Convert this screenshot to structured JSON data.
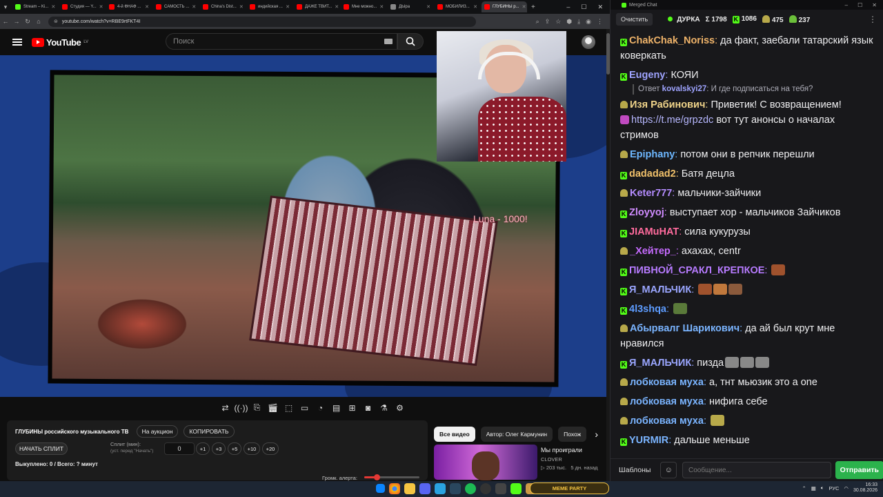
{
  "browser": {
    "tabs": [
      {
        "label": "Stream – Ki...",
        "color": "#53fc18"
      },
      {
        "label": "Студия — Y...",
        "color": "#ff0000"
      },
      {
        "label": "4-й ФНАФ ...",
        "color": "#ff0000"
      },
      {
        "label": "САМОСТЬ ...",
        "color": "#ff0000"
      },
      {
        "label": "China's Dist...",
        "color": "#ff0000"
      },
      {
        "label": "индийская ...",
        "color": "#ff0000"
      },
      {
        "label": "ДАЖЕ ТВИТ...",
        "color": "#ff0000"
      },
      {
        "label": "Мне можно...",
        "color": "#ff0000"
      },
      {
        "label": "ДЫра",
        "color": "#888888"
      },
      {
        "label": "МОБИЛИЗ...",
        "color": "#ff0000"
      },
      {
        "label": "ГЛУБИНЫ р...",
        "color": "#ff0000"
      }
    ],
    "url": "youtube.com/watch?v=RBE9rtFKT4I"
  },
  "youtube": {
    "logo": "YouTube",
    "region": "LV",
    "search_placeholder": "Поиск"
  },
  "overlay": {
    "donation_text": "Luna - 1000!"
  },
  "panel": {
    "title": "ГЛУБИНЫ российского музыкального ТВ",
    "auction_btn": "На аукцион",
    "copy_btn": "КОПИРОВАТЬ",
    "start_split_btn": "НАЧАТЬ СПЛИТ",
    "split_label": "Сплит (мин):",
    "split_hint": "(уст. перед \"Начать\")",
    "split_value": "0",
    "increments": [
      "+1",
      "+3",
      "+5",
      "+10",
      "+20"
    ],
    "bought": "Выкуплено: 0 / Всего: ? минут",
    "volume_label": "Громк. алерта:",
    "volume_fraction": 0.22
  },
  "chips": [
    "Все видео",
    "Автор: Олег Кармунин",
    "Похож"
  ],
  "recommendation": {
    "title": "Мы проиграли",
    "channel": "CLOVER",
    "views": "▷ 203 тыс.",
    "age": "5 дн. назад"
  },
  "chat": {
    "window_title": "Merged Chat",
    "clear_btn": "Очистить",
    "channel": "ДУРКА",
    "total": "Σ 1798",
    "kick_count": "1086",
    "twitch_count": "475",
    "other_count": "237",
    "messages": [
      {
        "platform": "kick",
        "nick": "ChakChak_Noriss",
        "color": "#f0b46a",
        "text": "да факт, заебали татарский язык коверкать"
      },
      {
        "platform": "kick",
        "nick": "Eugeny",
        "color": "#9fa4ff",
        "text": "КОЯИ",
        "reply_to": "kovalskyi27",
        "reply_text": "И где подписаться на тебя?"
      },
      {
        "platform": "twitch",
        "nick": "Изя Рабинович",
        "color": "#f0d48a",
        "text": "Приветик! С возвращением!",
        "link": "https://t.me/grpzdc",
        "tail": "вот тут анонсы о началах стримов"
      },
      {
        "platform": "twitch",
        "nick": "Epiphany",
        "color": "#6db7ff",
        "text": "потом они в репчик перешли"
      },
      {
        "platform": "kick",
        "nick": "dadadad2",
        "color": "#f0c06a",
        "text": "Батя децла"
      },
      {
        "platform": "twitch",
        "nick": "Keter777",
        "color": "#b48cff",
        "text": "мальчики-зайчики"
      },
      {
        "platform": "kick",
        "nick": "Zloyyoj",
        "color": "#d08cff",
        "text": "выступает хор - мальчиков Зайчиков"
      },
      {
        "platform": "kick",
        "nick": "JIAMuHAT",
        "color": "#ff6b9d",
        "text": "сила кукурузы"
      },
      {
        "platform": "twitch",
        "nick": "_Хейтер_",
        "color": "#c66bff",
        "text": "ахахах, centr"
      },
      {
        "platform": "kick",
        "nick": "ПИВНОЙ_СРАКЛ_КРЕПКОЕ",
        "color": "#b77bff",
        "text": ""
      },
      {
        "platform": "kick",
        "nick": "Я_МАЛЬЧИК",
        "color": "#9aa6ff",
        "text": ""
      },
      {
        "platform": "kick",
        "nick": "4l3shqa",
        "color": "#5d9cff",
        "text": ""
      },
      {
        "platform": "twitch",
        "nick": "Абырвалг Шарикович",
        "color": "#7ab4ff",
        "text": "да ай был крут мне нравился"
      },
      {
        "platform": "kick",
        "nick": "Я_МАЛЬЧИК",
        "color": "#9aa6ff",
        "text": "пизда"
      },
      {
        "platform": "twitch",
        "nick": "лобковая муха",
        "color": "#7ab4ff",
        "text": "а, тнт мьюзик это а one"
      },
      {
        "platform": "twitch",
        "nick": "лобковая муха",
        "color": "#7ab4ff",
        "text": "нифига себе"
      },
      {
        "platform": "twitch",
        "nick": "лобковая муха",
        "color": "#7ab4ff",
        "text": ""
      },
      {
        "platform": "kick",
        "nick": "YURMIR",
        "color": "#7ab4ff",
        "text": "дальше меньше"
      }
    ],
    "templates_btn": "Шаблоны",
    "input_placeholder": "Сообщение...",
    "send_btn": "Отправить"
  },
  "taskbar": {
    "meme_party": "MEME PARTY",
    "lang": "РУС",
    "time": "16:33",
    "date": "30.08.2026"
  }
}
